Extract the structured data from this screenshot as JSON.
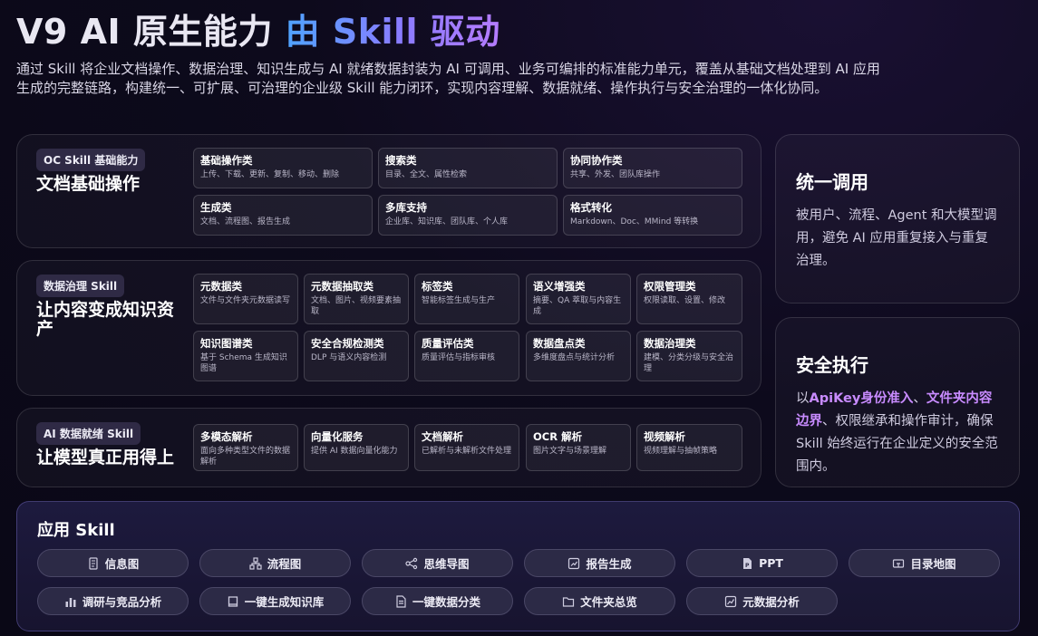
{
  "header": {
    "title_main": "V9 AI 原生能力 ",
    "title_highlight": "由 Skill 驱动",
    "description": "通过 Skill 将企业文档操作、数据治理、知识生成与 AI 就绪数据封装为 AI 可调用、业务可编排的标准能力单元，覆盖从基础文档处理到 AI 应用生成的完整链路，构建统一、可扩展、可治理的企业级 Skill 能力闭环，实现内容理解、数据就绪、操作执行与安全治理的一体化协同。"
  },
  "panels": [
    {
      "badge": "OC Skill 基础能力",
      "title": "文档基础操作",
      "cards": [
        {
          "title": "基础操作类",
          "desc": "上传、下载、更新、复制、移动、删除"
        },
        {
          "title": "搜索类",
          "desc": "目录、全文、属性检索"
        },
        {
          "title": "协同协作类",
          "desc": "共享、外发、团队库操作"
        },
        {
          "title": "生成类",
          "desc": "文档、流程图、报告生成"
        },
        {
          "title": "多库支持",
          "desc": "企业库、知识库、团队库、个人库"
        },
        {
          "title": "格式转化",
          "desc": "Markdown、Doc、MMind 等转换"
        }
      ]
    },
    {
      "badge": "数据治理 Skill",
      "title": "让内容变成知识资产",
      "cards": [
        {
          "title": "元数据类",
          "desc": "文件与文件夹元数据读写"
        },
        {
          "title": "元数据抽取类",
          "desc": "文档、图片、视频要素抽取"
        },
        {
          "title": "标签类",
          "desc": "智能标签生成与生产"
        },
        {
          "title": "语义增强类",
          "desc": "摘要、QA 萃取与内容生成"
        },
        {
          "title": "权限管理类",
          "desc": "权限读取、设置、修改"
        },
        {
          "title": "知识图谱类",
          "desc": "基于 Schema 生成知识图谱"
        },
        {
          "title": "安全合规检测类",
          "desc": "DLP 与语义内容检测"
        },
        {
          "title": "质量评估类",
          "desc": "质量评估与指标审核"
        },
        {
          "title": "数据盘点类",
          "desc": "多维度盘点与统计分析"
        },
        {
          "title": "数据治理类",
          "desc": "建模、分类分级与安全治理"
        }
      ]
    },
    {
      "badge": "AI 数据就绪 Skill",
      "title": "让模型真正用得上",
      "cards": [
        {
          "title": "多模态解析",
          "desc": "面向多种类型文件的数据解析"
        },
        {
          "title": "向量化服务",
          "desc": "提供 AI 数据向量化能力"
        },
        {
          "title": "文档解析",
          "desc": "已解析与未解析文件处理"
        },
        {
          "title": "OCR 解析",
          "desc": "图片文字与场景理解"
        },
        {
          "title": "视频解析",
          "desc": "视频理解与抽帧策略"
        }
      ]
    }
  ],
  "side_cards": [
    {
      "title": "统一调用",
      "desc": "被用户、流程、Agent 和大模型调用，避免 AI 应用重复接入与重复治理。"
    },
    {
      "title": "安全执行",
      "desc_prefix": "以",
      "desc_hl1": "ApiKey身份准入",
      "desc_sep": "、",
      "desc_hl2": "文件夹内容边界",
      "desc_suffix": "、权限继承和操作审计，确保 Skill 始终运行在企业定义的安全范围内。"
    }
  ],
  "app_skill": {
    "title": "应用 Skill",
    "pills": [
      {
        "label": "信息图",
        "icon": "infographic-icon"
      },
      {
        "label": "流程图",
        "icon": "flowchart-icon"
      },
      {
        "label": "思维导图",
        "icon": "mindmap-icon"
      },
      {
        "label": "报告生成",
        "icon": "report-icon"
      },
      {
        "label": "PPT",
        "icon": "ppt-icon"
      },
      {
        "label": "目录地图",
        "icon": "directory-map-icon"
      },
      {
        "label": "调研与竞品分析",
        "icon": "bar-chart-icon"
      },
      {
        "label": "一键生成知识库",
        "icon": "book-icon"
      },
      {
        "label": "一键数据分类",
        "icon": "document-icon"
      },
      {
        "label": "文件夹总览",
        "icon": "folder-icon"
      },
      {
        "label": "元数据分析",
        "icon": "line-chart-icon"
      }
    ]
  }
}
